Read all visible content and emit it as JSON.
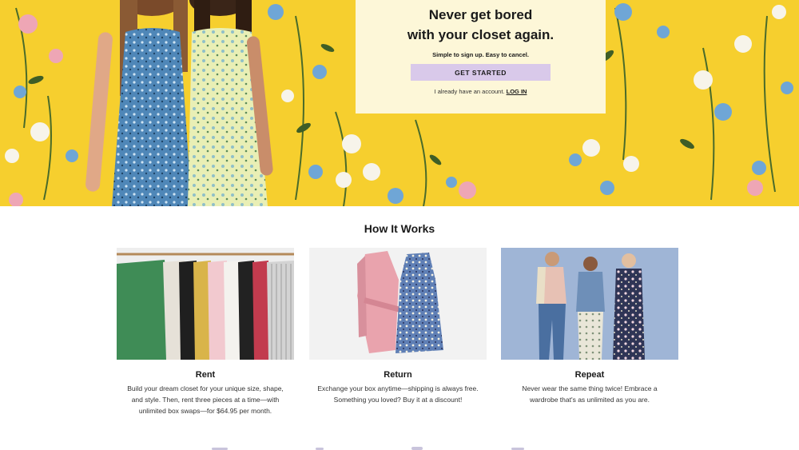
{
  "hero": {
    "headline_line1": "Never get bored",
    "headline_line2": "with your closet again.",
    "subtext": "Simple to sign up. Easy to cancel.",
    "cta_label": "GET STARTED",
    "login_prefix": "I already have an account.",
    "login_label": "LOG IN",
    "background_color": "#f6cf2e",
    "cta_color": "#d9c9ea"
  },
  "how_it_works": {
    "title": "How It Works",
    "steps": [
      {
        "title": "Rent",
        "desc_line1": "Build your dream closet for your unique size, shape,",
        "desc_line2": "and style. Then, rent three pieces at a time—with",
        "desc_line3": "unlimited box swaps—for $64.95 per month.",
        "image": "clothes-rack-photo"
      },
      {
        "title": "Return",
        "desc_line1": "Exchange your box anytime—shipping is always free.",
        "desc_line2": "Something you loved? Buy it at a discount!",
        "image": "pink-jacket-dress-photo"
      },
      {
        "title": "Repeat",
        "desc_line1": "Never wear the same thing twice! Embrace a",
        "desc_line2": "wardrobe that's as unlimited as you are.",
        "image": "three-women-photo"
      }
    ]
  }
}
